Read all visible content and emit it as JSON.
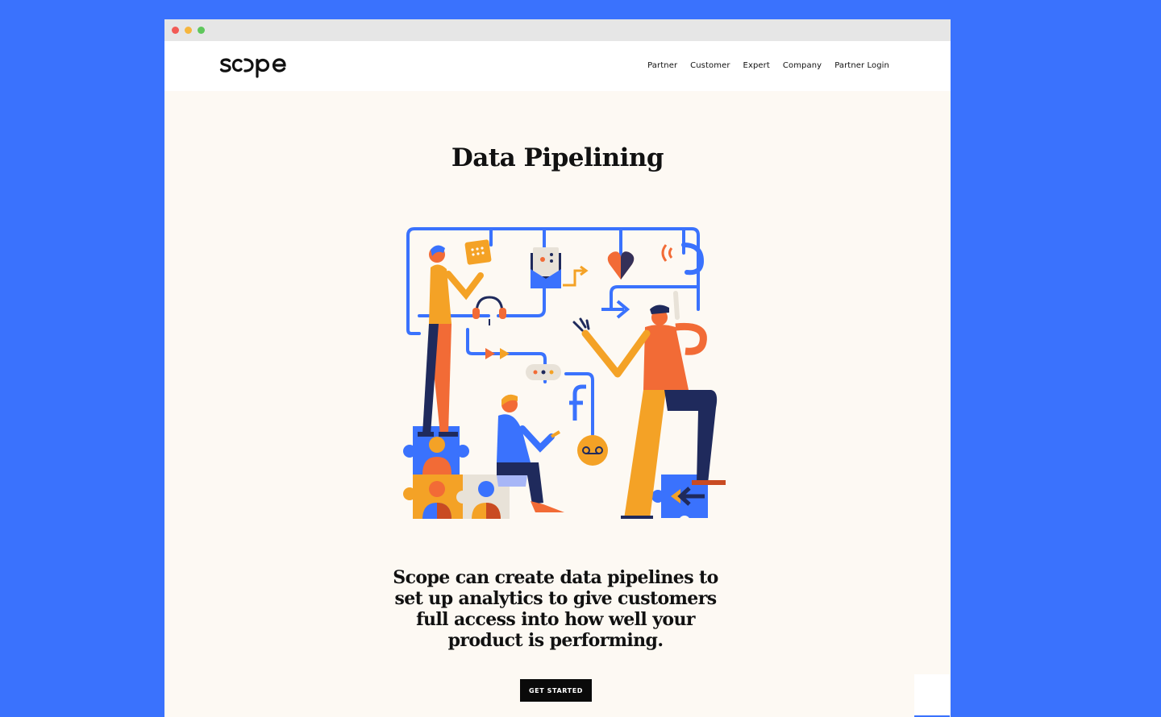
{
  "brand": {
    "logo_text": "scope"
  },
  "nav": {
    "items": [
      {
        "label": "Partner"
      },
      {
        "label": "Customer"
      },
      {
        "label": "Expert"
      },
      {
        "label": "Company"
      },
      {
        "label": "Partner Login"
      }
    ]
  },
  "hero": {
    "title": "Data Pipelining",
    "description": "Scope can create data pipelines to set up analytics to give customers full access into how well your product is performing.",
    "cta_label": "GET STARTED"
  },
  "colors": {
    "page_background": "#3a72fd",
    "content_background": "#fdf9f3",
    "accent_blue": "#3a72fd",
    "accent_orange": "#f4a226",
    "accent_red": "#f26b36",
    "navy": "#1f2a5c"
  }
}
